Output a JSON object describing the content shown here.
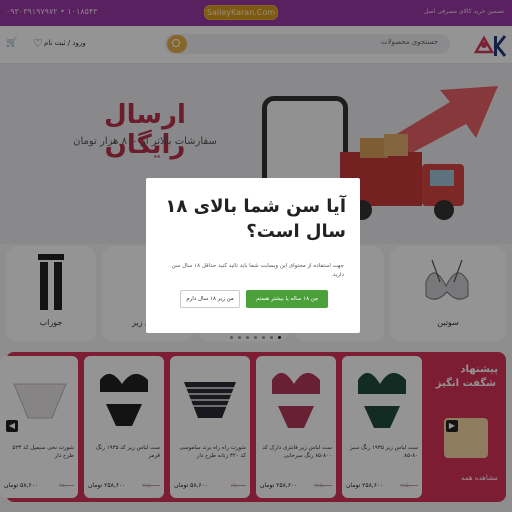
{
  "topbar": {
    "phone": "۰۹۳۰۳۹۱۹۷۹۷۲ • ۱۰۱۸۵۴۳",
    "domain": "SalleyKaran.Com",
    "tagline": "تضمین خرید کالای مصرفی اصل"
  },
  "header": {
    "search_placeholder": "جستجوی محصولات",
    "login": "ورود / ثبت نام",
    "cart": "۰ تومان"
  },
  "banner": {
    "title": "ارسال رایگان",
    "subtitle": "سفارشات بالاتر از ۸۰۰ هزار تومان"
  },
  "categories": [
    {
      "label": "جوراب"
    },
    {
      "label": "لباس زیر"
    },
    {
      "label": "ست"
    },
    {
      "label": "ست"
    },
    {
      "label": "سوتین"
    }
  ],
  "deals": {
    "promo_line1": "پیشنهاد",
    "promo_line2": "شگفت انگیز",
    "promo_more": "مشاهده همه",
    "products": [
      {
        "name": "ست لباس زیر ۱۹۳۵ رنگ سبز ۸۰-۸۵",
        "price": "۲۵۸,۶۰۰ تومان",
        "old": "۲۸۵,۰۰۰"
      },
      {
        "name": "ست لباس زیر فانتزی دارک کد ۸۰۰-۸۵ رنگ سرخابی",
        "price": "۲۵۸,۶۰۰ تومان",
        "old": "۲۸۵,۰۰۰"
      },
      {
        "name": "شورت راه راه برند ساموسی کد ۳۲۰ زنانه طرح دار",
        "price": "۵۸,۶۰۰ تومان",
        "old": "۶۵,۰۰۰"
      },
      {
        "name": "ست لباس زیر کد ۱۹۳۵ رنگ قرمز",
        "price": "۲۵۸,۶۰۰ تومان",
        "old": "۲۸۵,۰۰۰"
      },
      {
        "name": "شورت نخی سیمپل کد ۵۲۳ طرح دار",
        "price": "۵۸,۶۰۰ تومان",
        "old": "۶۵,۰۰۰"
      }
    ]
  },
  "modal": {
    "question": "آیا سن شما بالای ۱۸ سال است؟",
    "description": "جهت استفاده از محتوای این وبسایت شما باید تائید کنید حداقل ۱۸ سال سن دارید.",
    "yes_label": "من ۱۸ ساله یا بیشتر هستم",
    "no_label": "من زیر ۱۸ سال دارم"
  }
}
